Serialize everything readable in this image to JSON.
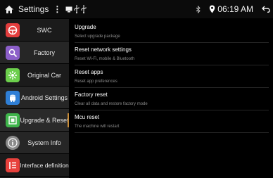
{
  "status_bar": {
    "title": "Settings",
    "kebab": "⋮",
    "time": "06:19 AM"
  },
  "sidebar": {
    "items": [
      {
        "label": "SWC",
        "icon": "steering-wheel-icon",
        "color": "#e23d3d"
      },
      {
        "label": "Factory",
        "icon": "factory-icon",
        "color": "#8c5fc9"
      },
      {
        "label": "Original Car",
        "icon": "gear-flower-icon",
        "color": "#6ccf4c"
      },
      {
        "label": "Android Settings",
        "icon": "android-icon",
        "color": "#2f7fd6"
      },
      {
        "label": "Upgrade & Reset",
        "icon": "upgrade-icon",
        "color": "#3fb54b"
      },
      {
        "label": "System Info",
        "icon": "info-icon",
        "color": "#8a8a8a"
      },
      {
        "label": "Interface definition",
        "icon": "interface-icon",
        "color": "#e8413c"
      }
    ]
  },
  "content": {
    "items": [
      {
        "title": "Upgrade",
        "subtitle": "Select upgrade package"
      },
      {
        "title": "Reset network settings",
        "subtitle": "Reset Wi-Fi, mobile & Bluetooth"
      },
      {
        "title": "Reset apps",
        "subtitle": "Reset app preferences"
      },
      {
        "title": "Factory reset",
        "subtitle": "Clear all data and restore factory mode"
      },
      {
        "title": "Mcu reset",
        "subtitle": "The machine will restart"
      }
    ]
  }
}
